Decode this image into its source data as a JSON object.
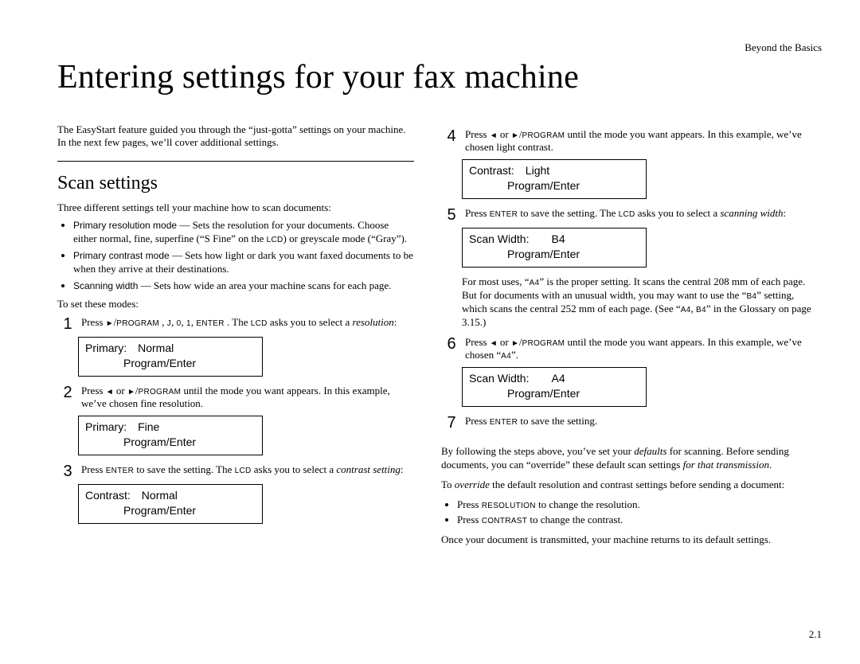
{
  "running_head": "Beyond the Basics",
  "title": "Entering settings for your fax machine",
  "intro_line1": "The EasyStart feature guided you through the “just-gotta” settings on your machine.",
  "intro_line2": "In the next few pages, we’ll cover additional settings.",
  "section_heading": "Scan settings",
  "lead": "Three different settings tell your machine how to scan documents:",
  "bullet1_label": "Primary resolution mode",
  "bullet1_text_a": " — Sets the resolution for your documents. Choose either normal, fine, superfine (“S Fine” on the ",
  "bullet1_text_b": ") or greyscale mode (“Gray”).",
  "bullet2_label": "Primary contrast mode",
  "bullet2_text": " — Sets how light or dark you want faxed documents to be when they arrive at their destinations.",
  "bullet3_label": "Scanning width",
  "bullet3_text": " — Sets how wide an area your machine scans for each page.",
  "to_set": "To set these modes:",
  "keys": {
    "program": "PROGRAM",
    "enter": "ENTER",
    "lcd": "LCD",
    "resolution": "RESOLUTION",
    "contrast": "CONTRAST",
    "j": "J",
    "zero": "0",
    "one": "1",
    "a4": "A4",
    "b4": "B4"
  },
  "arrows": {
    "left": "◄",
    "right": "►"
  },
  "step1_a": "Press ",
  "step1_b": " , ",
  "step1_c": ", ",
  "step1_d": ", ",
  "step1_e": ", ",
  "step1_f": " . The ",
  "step1_g": " asks you to select a ",
  "step1_em": "resolution",
  "step1_end": ":",
  "lcd1_l1": "Primary: Normal",
  "lcd_prog_enter": "Program/Enter",
  "step2_a": "Press ",
  "step2_b": " or ",
  "step2_c": " until the mode you want appears. In this example, we’ve chosen fine resolution.",
  "lcd2_l1": "Primary: Fine",
  "step3_a": "Press ",
  "step3_b": " to save the setting. The ",
  "step3_c": " asks you to select a ",
  "step3_em": "contrast setting",
  "step3_end": ":",
  "lcd3_l1": "Contrast: Normal",
  "step4_a": "Press ",
  "step4_b": " or ",
  "step4_c": " until the mode you want appears. In this example, we’ve chosen light contrast.",
  "lcd4_l1": "Contrast: Light",
  "step5_a": "Press ",
  "step5_b": " to save the setting. The ",
  "step5_c": " asks you to select a ",
  "step5_em": "scanning width",
  "step5_end": ":",
  "lcd5_l1": "Scan Width:  B4",
  "note_a": "For most uses, “",
  "note_b": "” is the proper setting. It scans the central 208 mm of each page. But for documents with an unusual width, you may want to use the “",
  "note_c": "” setting, which scans the central 252 mm of each page. (See “",
  "note_d": ", ",
  "note_e": "” in the Glossary on page 3.15.)",
  "step6_a": "Press ",
  "step6_b": " or ",
  "step6_c": " until the mode you want appears. In this example, we’ve chosen “",
  "step6_d": "”.",
  "lcd6_l1": "Scan Width:  A4",
  "step7_a": "Press ",
  "step7_b": " to save the setting.",
  "closing1_a": "By following the steps above, you’ve set your ",
  "closing1_em": "defaults",
  "closing1_b": " for scanning. Before sending documents, you can “override” these default scan settings ",
  "closing1_em2": "for that transmission",
  "closing1_c": ".",
  "closing2_a": "To ",
  "closing2_em": "override",
  "closing2_b": " the default resolution and contrast settings before sending a document:",
  "sub1_a": "Press ",
  "sub1_b": " to change the resolution.",
  "sub2_a": "Press ",
  "sub2_b": " to change the contrast.",
  "closing3": "Once your document is transmitted, your machine returns to its default settings.",
  "page_number": "2.1",
  "nums": {
    "n1": "1",
    "n2": "2",
    "n3": "3",
    "n4": "4",
    "n5": "5",
    "n6": "6",
    "n7": "7"
  }
}
